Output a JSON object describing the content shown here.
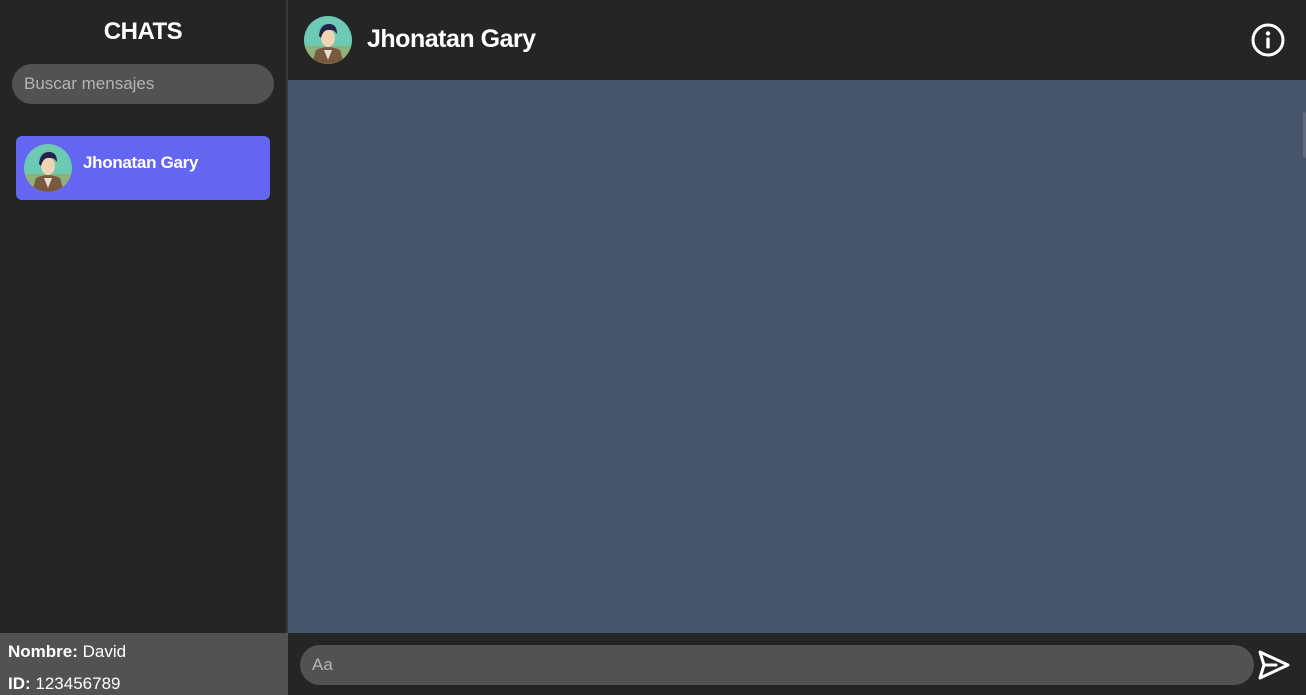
{
  "sidebar": {
    "title": "CHATS",
    "search_placeholder": "Buscar mensajes",
    "chats": [
      {
        "name": "Jhonatan Gary",
        "active": true
      }
    ]
  },
  "user": {
    "name_label": "Nombre:",
    "name_value": " David",
    "id_label": "ID:",
    "id_value": " 123456789"
  },
  "header": {
    "contact_name": "Jhonatan Gary",
    "info_icon": "info-circle-icon"
  },
  "composer": {
    "placeholder": "Aa",
    "send_icon": "send-icon"
  },
  "colors": {
    "accent": "#6466f1",
    "panel": "#252525",
    "input": "#525252",
    "chat_background": "#465569"
  }
}
